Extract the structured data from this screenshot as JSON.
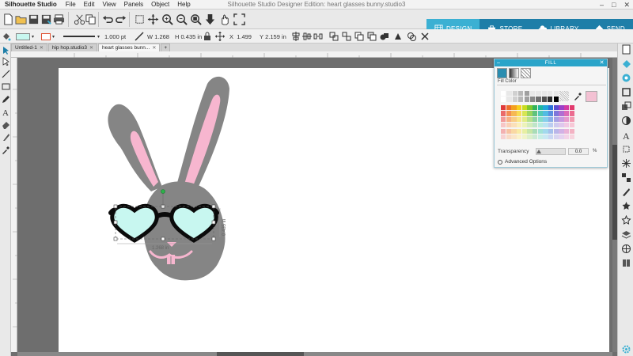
{
  "app": {
    "name": "Silhouette Studio",
    "window_title": "Silhouette Studio Designer Edition: heart glasses bunny.studio3",
    "menus": [
      "File",
      "Edit",
      "View",
      "Panels",
      "Object",
      "Help"
    ]
  },
  "nav_tabs": [
    {
      "label": "DESIGN",
      "icon": "grid-icon"
    },
    {
      "label": "STORE",
      "icon": "store-icon"
    },
    {
      "label": "LIBRARY",
      "icon": "cloud-icon"
    },
    {
      "label": "SEND",
      "icon": "send-icon"
    }
  ],
  "toolbar2": {
    "line_width": "1.000",
    "line_unit": "pt",
    "w_label": "W",
    "w_value": "1.268",
    "h_label": "H",
    "h_value": "0.435",
    "unit": "in",
    "x_label": "X",
    "x_value": "1.499",
    "y_label": "Y",
    "y_value": "2.159"
  },
  "doc_tabs": [
    {
      "label": "Untitled-1",
      "active": false
    },
    {
      "label": "hip hop.studio3",
      "active": false
    },
    {
      "label": "heart glasses bunn...",
      "active": true
    }
  ],
  "canvas": {
    "dim_width": "1.268 in",
    "dim_height": "0.435 in"
  },
  "fill_panel": {
    "title": "FILL",
    "section_label": "Fill Color",
    "transparency_label": "Transparency",
    "transparency_value": "0.0",
    "percent": "%",
    "advanced_label": "Advanced Options"
  },
  "colors": {
    "accent": "#3bb0d3",
    "nav_inactive": "#1e7ea8",
    "bunny_gray": "#858585",
    "bunny_pink": "#f7b6cf",
    "lens": "#c8f7f0",
    "frame": "#0a0a0a"
  }
}
